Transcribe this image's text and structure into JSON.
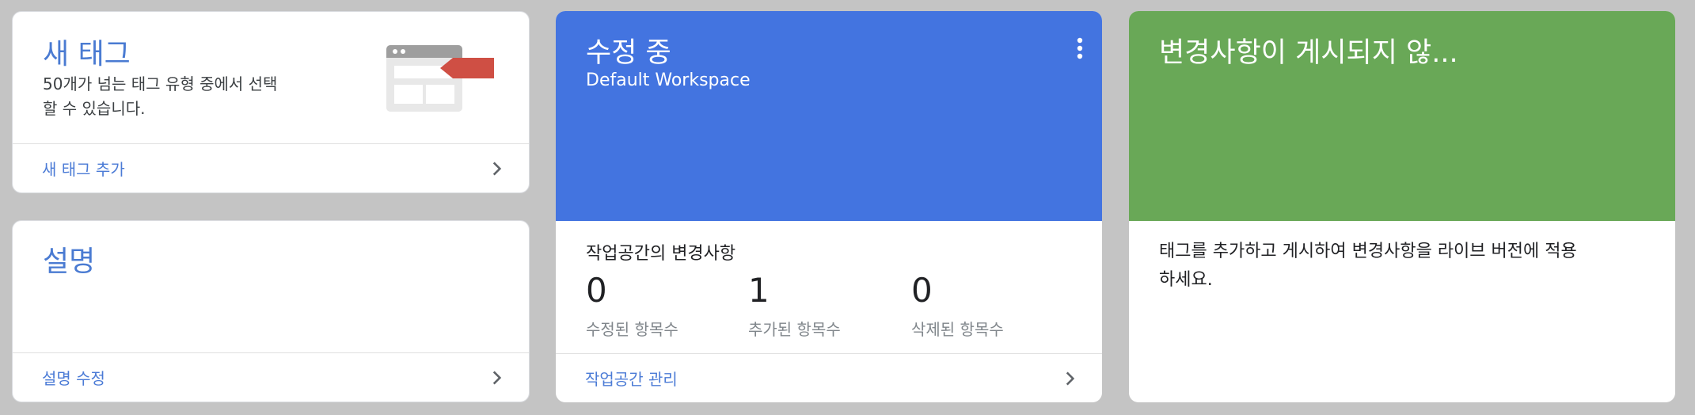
{
  "new_tag": {
    "title": "새 태그",
    "desc_line1": "50개가 넘는 태그 유형 중에서 선택",
    "desc_line2": "할 수 있습니다.",
    "link": "새 태그 추가"
  },
  "description": {
    "title": "설명",
    "link": "설명 수정"
  },
  "editing": {
    "title": "수정 중",
    "workspace": "Default Workspace",
    "changes_heading": "작업공간의 변경사항",
    "stats": [
      {
        "value": "0",
        "label": "수정된 항목수"
      },
      {
        "value": "1",
        "label": "추가된 항목수"
      },
      {
        "value": "0",
        "label": "삭제된 항목수"
      }
    ],
    "link": "작업공간 관리"
  },
  "unpublished": {
    "title": "변경사항이 게시되지 않...",
    "desc_line1": "태그를 추가하고 게시하여 변경사항을 라이브 버전에 적용",
    "desc_line2": "하세요."
  },
  "colors": {
    "blue_tile": "#4374e0",
    "green_tile": "#69a857",
    "link": "#4b7bd6",
    "tag_red": "#cf4f44"
  }
}
